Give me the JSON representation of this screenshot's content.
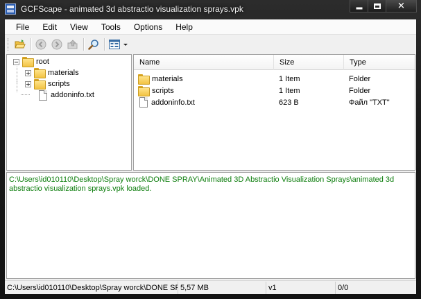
{
  "window": {
    "title": "GCFScape - animated 3d abstractio visualization sprays.vpk",
    "controls": {
      "minimize": "minimize",
      "maximize": "maximize",
      "close": "close"
    }
  },
  "menu": [
    "File",
    "Edit",
    "View",
    "Tools",
    "Options",
    "Help"
  ],
  "toolbar": {
    "icons": [
      "open-folder-icon",
      "back-icon",
      "forward-icon",
      "up-icon",
      "search-icon",
      "view-mode-icon"
    ]
  },
  "tree": {
    "root": "root",
    "children": [
      "materials",
      "scripts"
    ],
    "files": [
      "addoninfo.txt"
    ]
  },
  "list": {
    "columns": [
      "Name",
      "Size",
      "Type"
    ],
    "rows": [
      {
        "name": "materials",
        "size": "1 Item",
        "type": "Folder",
        "icon": "folder-icon"
      },
      {
        "name": "scripts",
        "size": "1 Item",
        "type": "Folder",
        "icon": "folder-icon"
      },
      {
        "name": "addoninfo.txt",
        "size": "623 B",
        "type": "Файл \"TXT\"",
        "icon": "file-icon"
      }
    ]
  },
  "log": {
    "lines": [
      "C:\\Users\\id010110\\Desktop\\Spray worck\\DONE SPRAY\\Animated 3D Abstractio Visualization Sprays\\animated 3d",
      "abstractio visualization sprays.vpk loaded."
    ]
  },
  "status": {
    "path": "C:\\Users\\id010110\\Desktop\\Spray worck\\DONE SPRA",
    "size": "5,57 MB",
    "version": "v1",
    "count": "0/0"
  },
  "colors": {
    "log_text": "#0a7c0a",
    "frame": "#1b1b1b",
    "folder": "#f2c343"
  }
}
